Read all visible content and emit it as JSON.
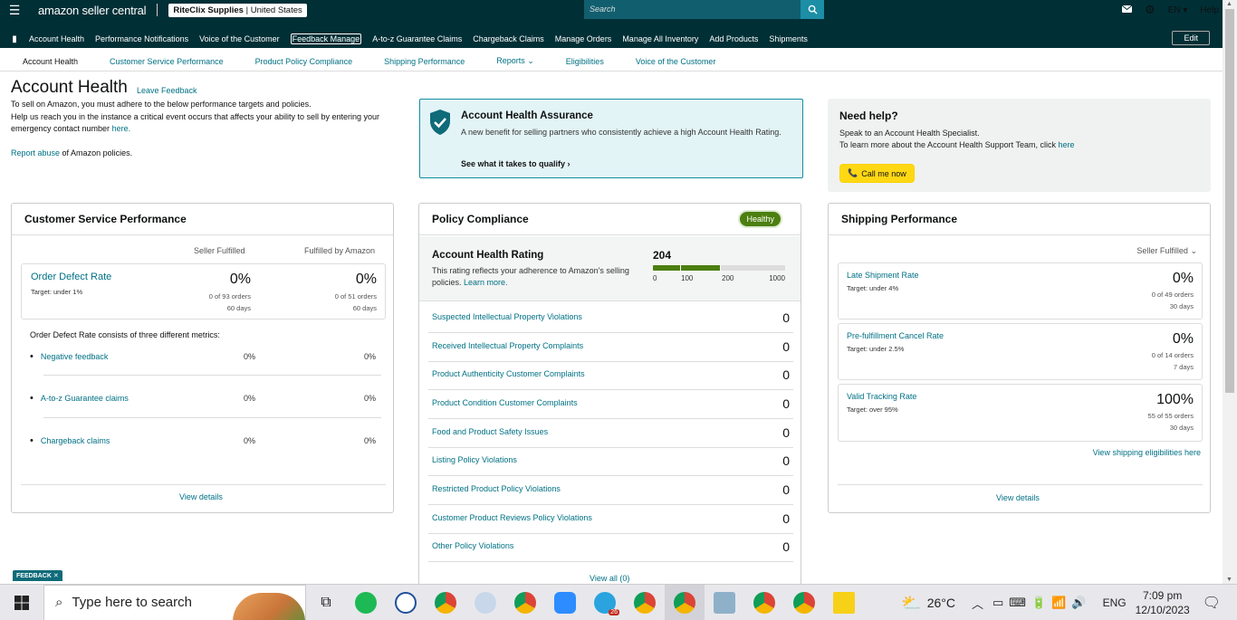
{
  "top": {
    "logo": "amazon seller central",
    "store_name": "RiteClix Supplies",
    "store_region": "United States",
    "search_placeholder": "Search",
    "lang": "EN",
    "help": "Help"
  },
  "nav": {
    "items": [
      "Account Health",
      "Performance Notifications",
      "Voice of the Customer",
      "Feedback Manage",
      "A-to-z Guarantee Claims",
      "Chargeback Claims",
      "Manage Orders",
      "Manage All Inventory",
      "Add Products",
      "Shipments"
    ],
    "edit": "Edit"
  },
  "subnav": [
    "Account Health",
    "Customer Service Performance",
    "Product Policy Compliance",
    "Shipping Performance",
    "Reports",
    "Eligibilities",
    "Voice of the Customer"
  ],
  "header": {
    "title": "Account Health",
    "leave_feedback": "Leave Feedback",
    "intro_1": "To sell on Amazon, you must adhere to the below performance targets and policies.",
    "intro_2": "Help us reach you in the instance a critical event occurs that affects your ability to sell by entering your emergency contact number",
    "intro_here": "here.",
    "report_link": "Report abuse",
    "report_rest": " of Amazon policies."
  },
  "assurance": {
    "title": "Account Health Assurance",
    "body": "A new benefit for selling partners who consistently achieve a high Account Health Rating.",
    "link": "See what it takes to qualify"
  },
  "help": {
    "title": "Need help?",
    "line1": "Speak to an Account Health Specialist.",
    "line2": "To learn more about the Account Health Support Team, click",
    "line2_link": "here",
    "button": "Call me now"
  },
  "csp": {
    "title": "Customer Service Performance",
    "col1": "Seller Fulfilled",
    "col2": "Fulfilled by Amazon",
    "odr": {
      "name": "Order Defect Rate",
      "target": "Target: under 1%",
      "sf_pct": "0%",
      "sf_orders": "0 of 93 orders",
      "sf_days": "60 days",
      "fba_pct": "0%",
      "fba_orders": "0 of 51 orders",
      "fba_days": "60 days"
    },
    "metrics_intro": "Order Defect Rate consists of three different metrics:",
    "metrics": [
      {
        "name": "Negative feedback",
        "sf": "0%",
        "fba": "0%"
      },
      {
        "name": "A-to-z Guarantee claims",
        "sf": "0%",
        "fba": "0%"
      },
      {
        "name": "Chargeback claims",
        "sf": "0%",
        "fba": "0%"
      }
    ],
    "view_details": "View details"
  },
  "pc": {
    "title": "Policy Compliance",
    "status": "Healthy",
    "rating_title": "Account Health Rating",
    "rating_desc": "This rating reflects your adherence to Amazon's selling policies.",
    "learn_more": "Learn more.",
    "score": "204",
    "score_value": 204,
    "scale": [
      "0",
      "100",
      "200",
      "1000"
    ],
    "violations": [
      {
        "name": "Suspected Intellectual Property Violations",
        "count": "0"
      },
      {
        "name": "Received Intellectual Property Complaints",
        "count": "0"
      },
      {
        "name": "Product Authenticity Customer Complaints",
        "count": "0"
      },
      {
        "name": "Product Condition Customer Complaints",
        "count": "0"
      },
      {
        "name": "Food and Product Safety Issues",
        "count": "0"
      },
      {
        "name": "Listing Policy Violations",
        "count": "0"
      },
      {
        "name": "Restricted Product Policy Violations",
        "count": "0"
      },
      {
        "name": "Customer Product Reviews Policy Violations",
        "count": "0"
      },
      {
        "name": "Other Policy Violations",
        "count": "0"
      }
    ],
    "view_all": "View all (0)"
  },
  "sp": {
    "title": "Shipping Performance",
    "filter": "Seller Fulfilled",
    "metrics": [
      {
        "name": "Late Shipment Rate",
        "target": "Target: under 4%",
        "pct": "0%",
        "orders": "0 of 49 orders",
        "days": "30 days"
      },
      {
        "name": "Pre-fulfillment Cancel Rate",
        "target": "Target: under 2.5%",
        "pct": "0%",
        "orders": "0 of 14 orders",
        "days": "7 days"
      },
      {
        "name": "Valid Tracking Rate",
        "target": "Target: over 95%",
        "pct": "100%",
        "orders": "55 of 55 orders",
        "days": "30 days"
      }
    ],
    "eligibilities": "View shipping eligibilities here",
    "view_details": "View details"
  },
  "feedback_tab": "FEEDBACK ✕",
  "taskbar": {
    "search": "Type here to search",
    "weather": "26°C",
    "lang": "ENG",
    "time": "7:09 pm",
    "date": "12/10/2023",
    "badge": "26"
  },
  "colors": {
    "teal": "#002f36",
    "link": "#007185",
    "healthy": "#4c7f10",
    "yellow": "#ffd814"
  }
}
